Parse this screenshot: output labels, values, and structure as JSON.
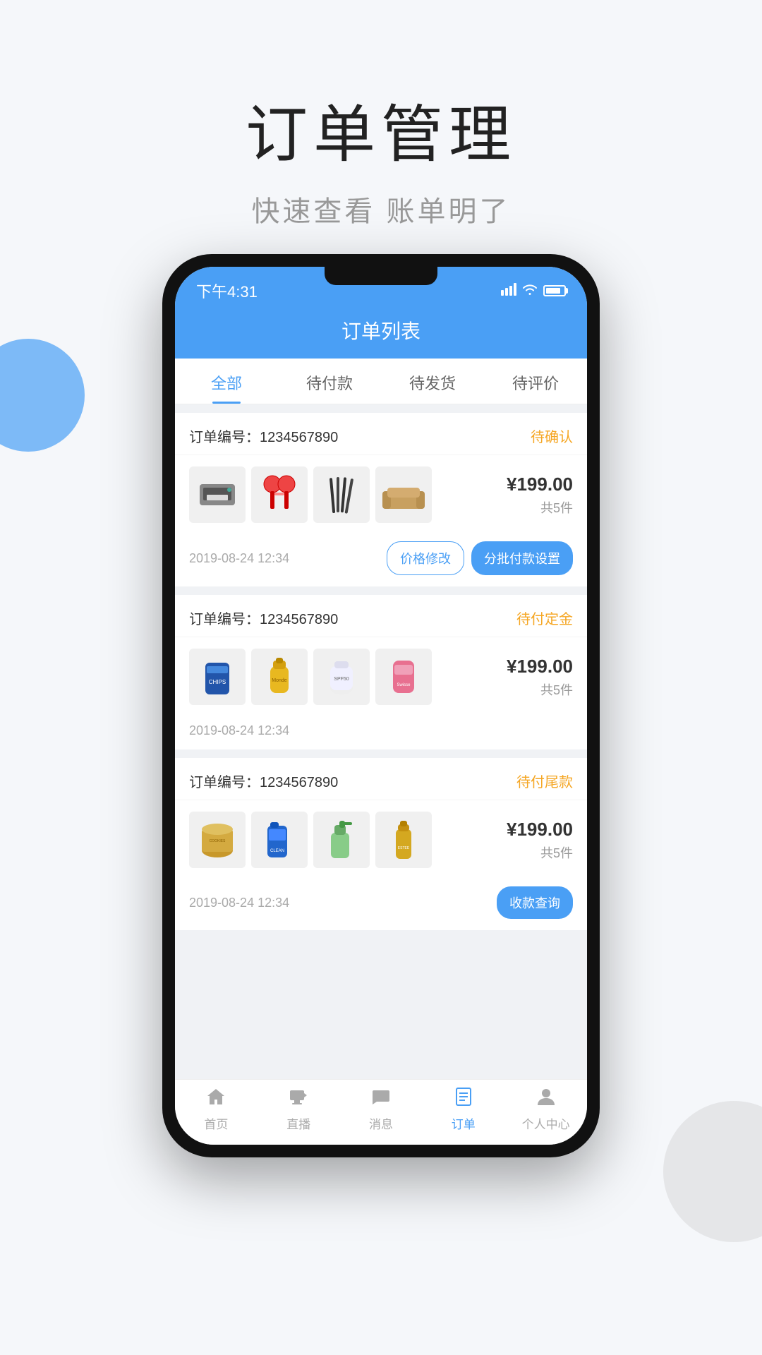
{
  "page": {
    "title": "订单管理",
    "subtitle": "快速查看 账单明了"
  },
  "phone": {
    "status_bar": {
      "time": "下午4:31"
    },
    "header": {
      "title": "订单列表"
    },
    "tabs": [
      {
        "label": "全部",
        "active": true
      },
      {
        "label": "待付款",
        "active": false
      },
      {
        "label": "待发货",
        "active": false
      },
      {
        "label": "待评价",
        "active": false
      }
    ],
    "orders": [
      {
        "number_label": "订单编号：",
        "number": "1234567890",
        "status": "待确认",
        "status_class": "status-pending",
        "price": "¥199.00",
        "count": "共5件",
        "date": "2019-08-24 12:34",
        "actions": [
          {
            "label": "价格修改",
            "type": "outline"
          },
          {
            "label": "分批付款设置",
            "type": "primary"
          }
        ]
      },
      {
        "number_label": "订单编号：",
        "number": "1234567890",
        "status": "待付定金",
        "status_class": "status-deposit",
        "price": "¥199.00",
        "count": "共5件",
        "date": "2019-08-24 12:34",
        "actions": []
      },
      {
        "number_label": "订单编号：",
        "number": "1234567890",
        "status": "待付尾款",
        "status_class": "status-balance",
        "price": "¥199.00",
        "count": "共5件",
        "date": "2019-08-24 12:34",
        "actions": [
          {
            "label": "收款查询",
            "type": "primary"
          }
        ]
      }
    ],
    "bottom_nav": [
      {
        "label": "首页",
        "icon": "🏠",
        "active": false
      },
      {
        "label": "直播",
        "icon": "📺",
        "active": false
      },
      {
        "label": "消息",
        "icon": "💬",
        "active": false
      },
      {
        "label": "订单",
        "icon": "📋",
        "active": true
      },
      {
        "label": "个人中心",
        "icon": "👤",
        "active": false
      }
    ]
  }
}
